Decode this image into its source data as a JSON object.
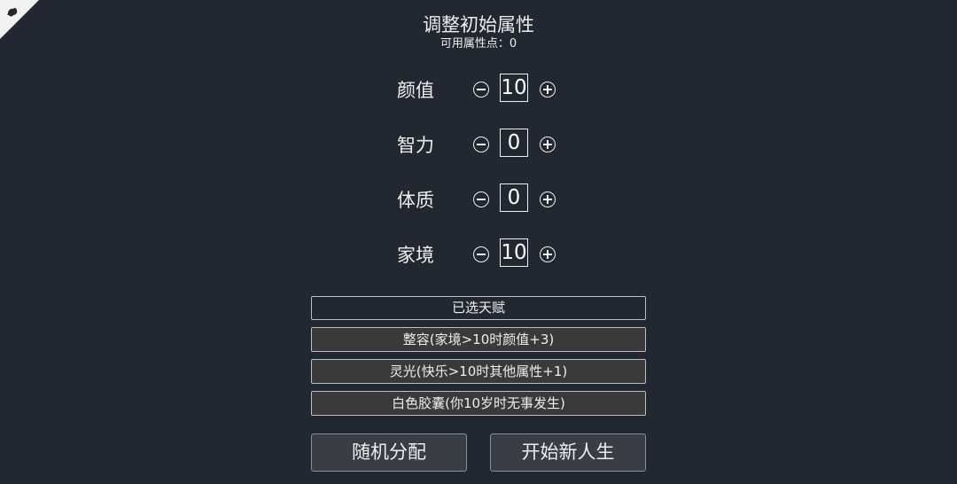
{
  "header": {
    "title": "调整初始属性",
    "available_points_label": "可用属性点：0"
  },
  "attributes": [
    {
      "label": "颜值",
      "value": "10"
    },
    {
      "label": "智力",
      "value": "0"
    },
    {
      "label": "体质",
      "value": "0"
    },
    {
      "label": "家境",
      "value": "10"
    }
  ],
  "talents": {
    "header": "已选天赋",
    "items": [
      "整容(家境>10时颜值+3)",
      "灵光(快乐>10时其他属性+1)",
      "白色胶囊(你10岁时无事发生)"
    ]
  },
  "actions": {
    "random_label": "随机分配",
    "start_label": "开始新人生"
  },
  "icons": {
    "corner": "theme-toggle-icon",
    "minus": "minus-circle-icon",
    "plus": "plus-circle-icon"
  },
  "colors": {
    "background": "#222831",
    "text": "#eeeeee",
    "talent_item_bg": "#3a3a3a",
    "button_bg": "#393e46"
  }
}
